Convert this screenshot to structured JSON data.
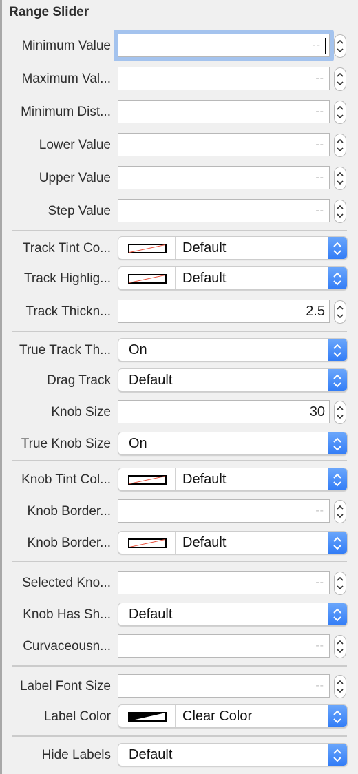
{
  "section": {
    "title": "Range Slider"
  },
  "rows": [
    {
      "label": "Minimum Value",
      "type": "number",
      "value": "",
      "placeholder": "--",
      "focused": true
    },
    {
      "label": "Maximum Val...",
      "type": "number",
      "value": "",
      "placeholder": "--"
    },
    {
      "label": "Minimum Dist...",
      "type": "number",
      "value": "",
      "placeholder": "--"
    },
    {
      "label": "Lower Value",
      "type": "number",
      "value": "",
      "placeholder": "--"
    },
    {
      "label": "Upper Value",
      "type": "number",
      "value": "",
      "placeholder": "--"
    },
    {
      "label": "Step Value",
      "type": "number",
      "value": "",
      "placeholder": "--"
    },
    {
      "label": "Track Tint Co...",
      "type": "color",
      "value": "Default",
      "swatch": "default"
    },
    {
      "label": "Track Highlig...",
      "type": "color",
      "value": "Default",
      "swatch": "default"
    },
    {
      "label": "Track Thickn...",
      "type": "number",
      "value": "2.5",
      "placeholder": "--"
    },
    {
      "label": "True Track Th...",
      "type": "popup",
      "value": "On"
    },
    {
      "label": "Drag Track",
      "type": "popup",
      "value": "Default"
    },
    {
      "label": "Knob Size",
      "type": "number",
      "value": "30",
      "placeholder": "--"
    },
    {
      "label": "True Knob Size",
      "type": "popup",
      "value": "On"
    },
    {
      "label": "Knob Tint Col...",
      "type": "color",
      "value": "Default",
      "swatch": "default"
    },
    {
      "label": "Knob Border...",
      "type": "number",
      "value": "",
      "placeholder": "--"
    },
    {
      "label": "Knob Border...",
      "type": "color",
      "value": "Default",
      "swatch": "default"
    },
    {
      "label": "Selected Kno...",
      "type": "number",
      "value": "",
      "placeholder": "--"
    },
    {
      "label": "Knob Has Sh...",
      "type": "popup",
      "value": "Default"
    },
    {
      "label": "Curvaceousn...",
      "type": "number",
      "value": "",
      "placeholder": "--"
    },
    {
      "label": "Label Font Size",
      "type": "number",
      "value": "",
      "placeholder": "--"
    },
    {
      "label": "Label Color",
      "type": "color",
      "value": "Clear Color",
      "swatch": "clear"
    },
    {
      "label": "Hide Labels",
      "type": "popup",
      "value": "Default"
    }
  ],
  "colors": {
    "accent": "#3b82f6",
    "focus_ring": "#a4c3ee",
    "default_swatch_line": "#e8533f"
  }
}
